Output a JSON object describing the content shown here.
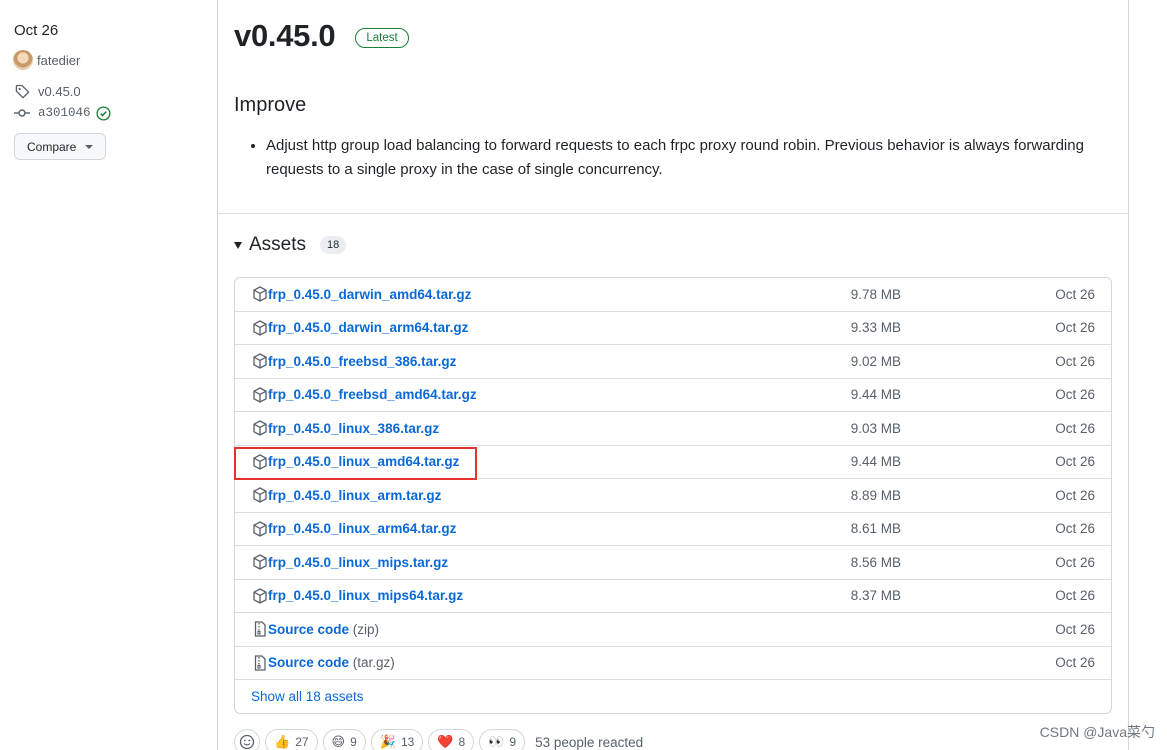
{
  "sidebar": {
    "date": "Oct 26",
    "author": "fatedier",
    "tag": "v0.45.0",
    "commit": "a301046",
    "compare_label": "Compare"
  },
  "release": {
    "title": "v0.45.0",
    "badge": "Latest",
    "section_heading": "Improve",
    "notes": [
      "Adjust http group load balancing to forward requests to each frpc proxy round robin. Previous behavior is always forwarding requests to a single proxy in the case of single concurrency."
    ]
  },
  "assets": {
    "title": "Assets",
    "count": "18",
    "rows": [
      {
        "name": "frp_0.45.0_darwin_amd64.tar.gz",
        "size": "9.78 MB",
        "date": "Oct 26"
      },
      {
        "name": "frp_0.45.0_darwin_arm64.tar.gz",
        "size": "9.33 MB",
        "date": "Oct 26"
      },
      {
        "name": "frp_0.45.0_freebsd_386.tar.gz",
        "size": "9.02 MB",
        "date": "Oct 26"
      },
      {
        "name": "frp_0.45.0_freebsd_amd64.tar.gz",
        "size": "9.44 MB",
        "date": "Oct 26"
      },
      {
        "name": "frp_0.45.0_linux_386.tar.gz",
        "size": "9.03 MB",
        "date": "Oct 26"
      },
      {
        "name": "frp_0.45.0_linux_amd64.tar.gz",
        "size": "9.44 MB",
        "date": "Oct 26"
      },
      {
        "name": "frp_0.45.0_linux_arm.tar.gz",
        "size": "8.89 MB",
        "date": "Oct 26"
      },
      {
        "name": "frp_0.45.0_linux_arm64.tar.gz",
        "size": "8.61 MB",
        "date": "Oct 26"
      },
      {
        "name": "frp_0.45.0_linux_mips.tar.gz",
        "size": "8.56 MB",
        "date": "Oct 26"
      },
      {
        "name": "frp_0.45.0_linux_mips64.tar.gz",
        "size": "8.37 MB",
        "date": "Oct 26"
      }
    ],
    "source": [
      {
        "name": "Source code",
        "ext": "(zip)",
        "date": "Oct 26"
      },
      {
        "name": "Source code",
        "ext": "(tar.gz)",
        "date": "Oct 26"
      }
    ],
    "show_all": "Show all 18 assets"
  },
  "reactions": {
    "items": [
      {
        "emoji": "👍",
        "count": "27"
      },
      {
        "emoji": "😄",
        "count": "9"
      },
      {
        "emoji": "🎉",
        "count": "13"
      },
      {
        "emoji": "❤️",
        "count": "8"
      },
      {
        "emoji": "👀",
        "count": "9"
      }
    ],
    "summary": "53 people reacted"
  },
  "watermark": "CSDN @Java菜勺",
  "colors": {
    "link": "#0969da",
    "latest_badge": "#1a7f37",
    "highlight_box": "#e5322d",
    "verified": "#1a7f37"
  }
}
